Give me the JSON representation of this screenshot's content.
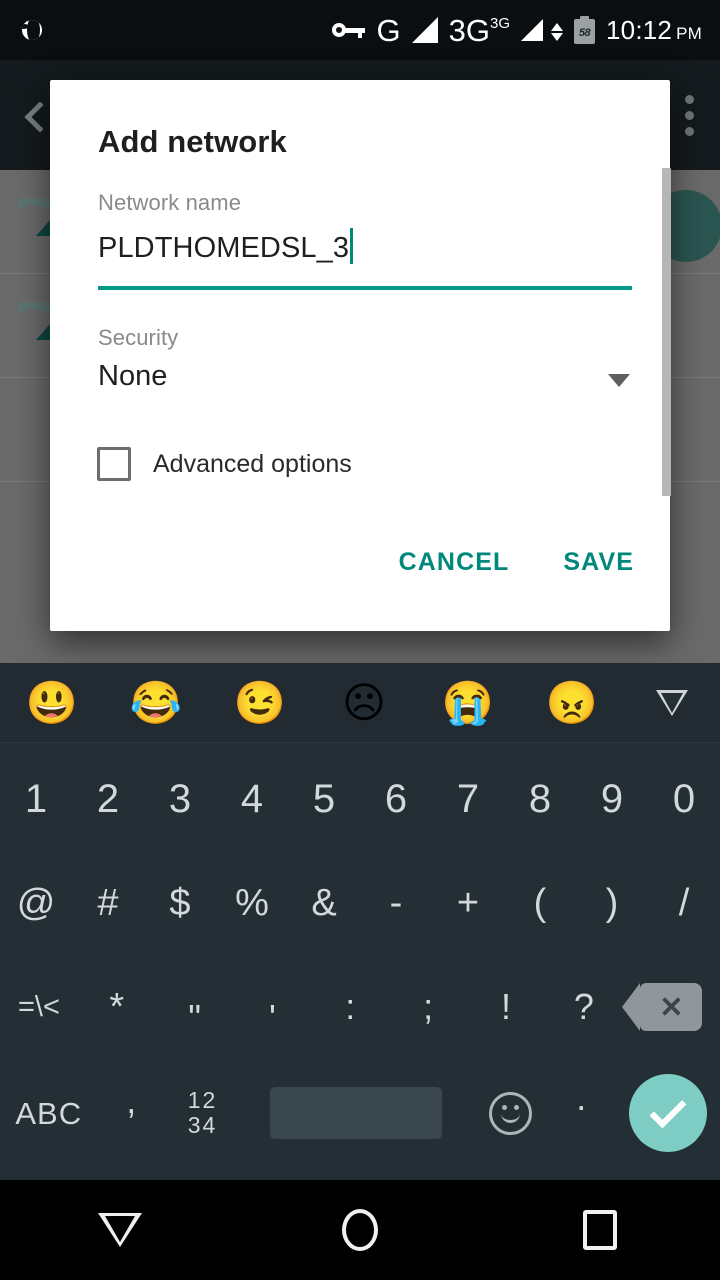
{
  "status_bar": {
    "globe_icon": "globe-icon",
    "vpn_key_icon": "key-icon",
    "sim1_label": "G",
    "sim2_label": "3G",
    "sim2_superscript": "3G",
    "battery_level": "58",
    "time": "10:12",
    "am_pm": "PM"
  },
  "background_app": {
    "back_icon": "back-arrow-icon",
    "overflow_icon": "overflow-menu-icon",
    "wifi_rows": 2,
    "fab_color": "#2b5551"
  },
  "dialog": {
    "title": "Add network",
    "network_name": {
      "label": "Network name",
      "value": "PLDTHOMEDSL_3",
      "underline_color": "#009688",
      "caret_color": "#00897b"
    },
    "security": {
      "label": "Security",
      "value": "None",
      "dropdown_icon": "chevron-down-icon"
    },
    "advanced_options": {
      "label": "Advanced options",
      "checked": false
    },
    "buttons": {
      "cancel": "CANCEL",
      "save": "SAVE",
      "accent_color": "#00897b"
    }
  },
  "keyboard": {
    "emoji_suggestions": [
      "😃",
      "😂",
      "😉",
      "☹",
      "😭",
      "😠"
    ],
    "collapse_icon": "collapse-triangle-icon",
    "row_numbers": [
      "1",
      "2",
      "3",
      "4",
      "5",
      "6",
      "7",
      "8",
      "9",
      "0"
    ],
    "row_symbols": [
      "@",
      "#",
      "$",
      "%",
      "&",
      "-",
      "+",
      "(",
      ")",
      "/"
    ],
    "row_punct": [
      "=\\<",
      "*",
      "\"",
      "'",
      ":",
      ";",
      "!",
      "?"
    ],
    "backspace_icon": "backspace-icon",
    "bottom": {
      "alpha_key": "ABC",
      "comma_key": ",",
      "numeric_key_top": "12",
      "numeric_key_bottom": "34",
      "space_key": "space-bar",
      "emoji_key": "smiley-icon",
      "period_key": ".",
      "enter_key": "check-icon",
      "enter_color": "#7ecdc4"
    }
  },
  "nav_bar": {
    "back": "back-down-triangle-icon",
    "home": "home-circle-icon",
    "recents": "recents-square-icon"
  }
}
